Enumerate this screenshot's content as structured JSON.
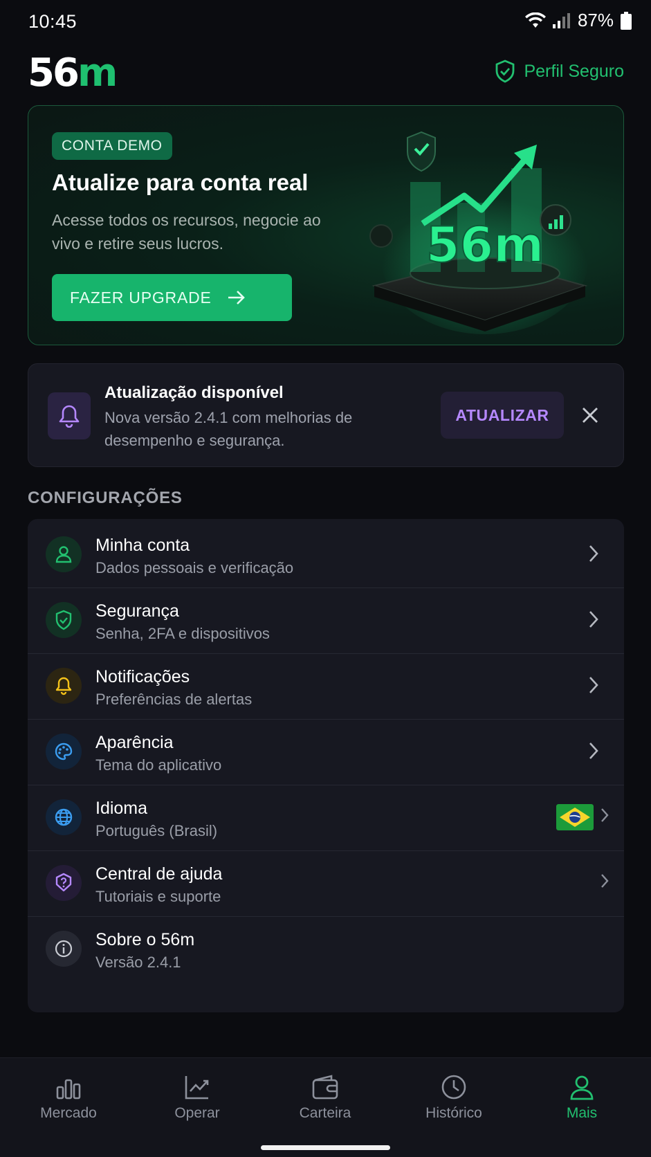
{
  "status": {
    "time": "10:45",
    "battery": "87%"
  },
  "header": {
    "logo_main": "56",
    "logo_accent": "m",
    "secure_label": "Perfil Seguro"
  },
  "promo": {
    "badge": "CONTA DEMO",
    "title": "Atualize para conta real",
    "description": "Acesse todos os recursos, negocie ao vivo e retire seus lucros.",
    "button_label": "FAZER UPGRADE",
    "art_logo": "56m"
  },
  "update": {
    "title": "Atualização disponível",
    "description": "Nova versão 2.4.1 com melhorias de desempenho e segurança.",
    "button_label": "ATUALIZAR"
  },
  "settings": {
    "section_label": "CONFIGURAÇÕES",
    "items": [
      {
        "title": "Minha conta",
        "subtitle": "Dados pessoais e verificação",
        "icon": "user-icon"
      },
      {
        "title": "Segurança",
        "subtitle": "Senha, 2FA e dispositivos",
        "icon": "shield-icon"
      },
      {
        "title": "Notificações",
        "subtitle": "Preferências de alertas",
        "icon": "bell-icon"
      },
      {
        "title": "Aparência",
        "subtitle": "Tema do aplicativo",
        "icon": "palette-icon"
      },
      {
        "title": "Idioma",
        "subtitle": "Português (Brasil)",
        "icon": "globe-icon"
      },
      {
        "title": "Central de ajuda",
        "subtitle": "Tutoriais e suporte",
        "icon": "help-icon"
      },
      {
        "title": "Sobre o 56m",
        "subtitle": "Versão 2.4.1",
        "icon": "info-icon"
      }
    ]
  },
  "nav": {
    "items": [
      {
        "label": "Mercado",
        "icon": "bar-chart-icon"
      },
      {
        "label": "Operar",
        "icon": "trend-chart-icon"
      },
      {
        "label": "Carteira",
        "icon": "wallet-icon"
      },
      {
        "label": "Histórico",
        "icon": "clock-icon"
      },
      {
        "label": "Mais",
        "icon": "user-icon"
      }
    ],
    "active": "Mais"
  },
  "colors": {
    "accent": "#22c070",
    "purple": "#b588ff",
    "background": "#0b0c10",
    "card": "#171821"
  }
}
